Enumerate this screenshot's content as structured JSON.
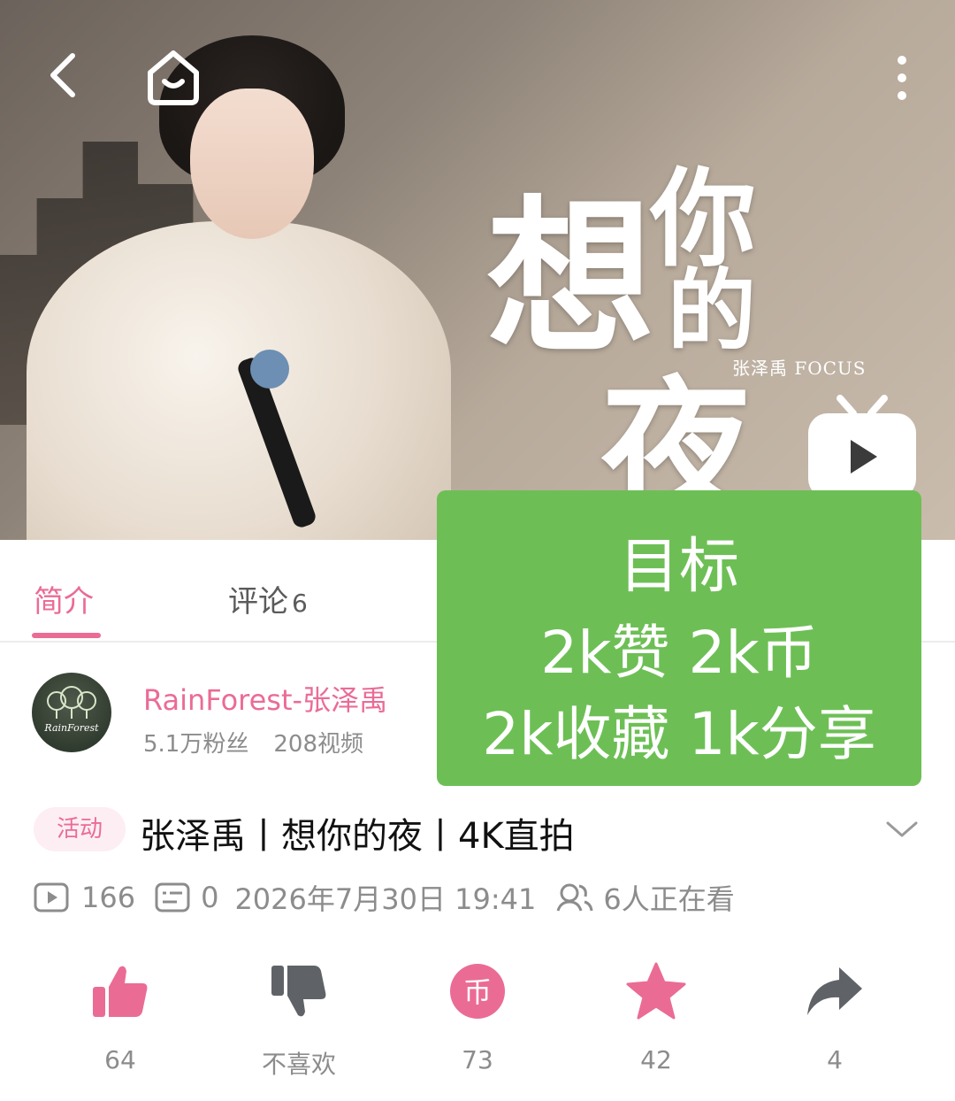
{
  "video": {
    "calligraphy_title": [
      "想",
      "你",
      "的",
      "夜"
    ],
    "focus_caption": "张泽禹 FOCUS"
  },
  "tabs": {
    "intro": "简介",
    "comments": "评论",
    "comments_count": "6"
  },
  "overlay": {
    "line1": "目标",
    "line2": "2k赞 2k币",
    "line3": "2k收藏 1k分享"
  },
  "uploader": {
    "name": "RainForest-张泽禹",
    "fans": "5.1万粉丝",
    "videos": "208视频",
    "avatar_text": "RainForest"
  },
  "details": {
    "activity_tag": "活动",
    "title": "张泽禹丨想你的夜丨4K直拍",
    "plays": "166",
    "danmaku": "0",
    "datetime": "2026年7月30日 19:41",
    "watching": "6人正在看"
  },
  "actions": {
    "like": "64",
    "dislike": "不喜欢",
    "coin": "73",
    "favorite": "42",
    "share": "4"
  },
  "colors": {
    "accent_pink": "#ea6c95",
    "overlay_green": "#6dbf55",
    "muted_gray": "#8c8c8c"
  },
  "icons": [
    "back-icon",
    "home-icon",
    "more-icon",
    "bilibili-tv-icon",
    "play-count-icon",
    "danmaku-icon",
    "viewers-icon",
    "chevron-down-icon",
    "thumb-up-icon",
    "thumb-down-icon",
    "coin-icon",
    "star-icon",
    "share-icon"
  ]
}
